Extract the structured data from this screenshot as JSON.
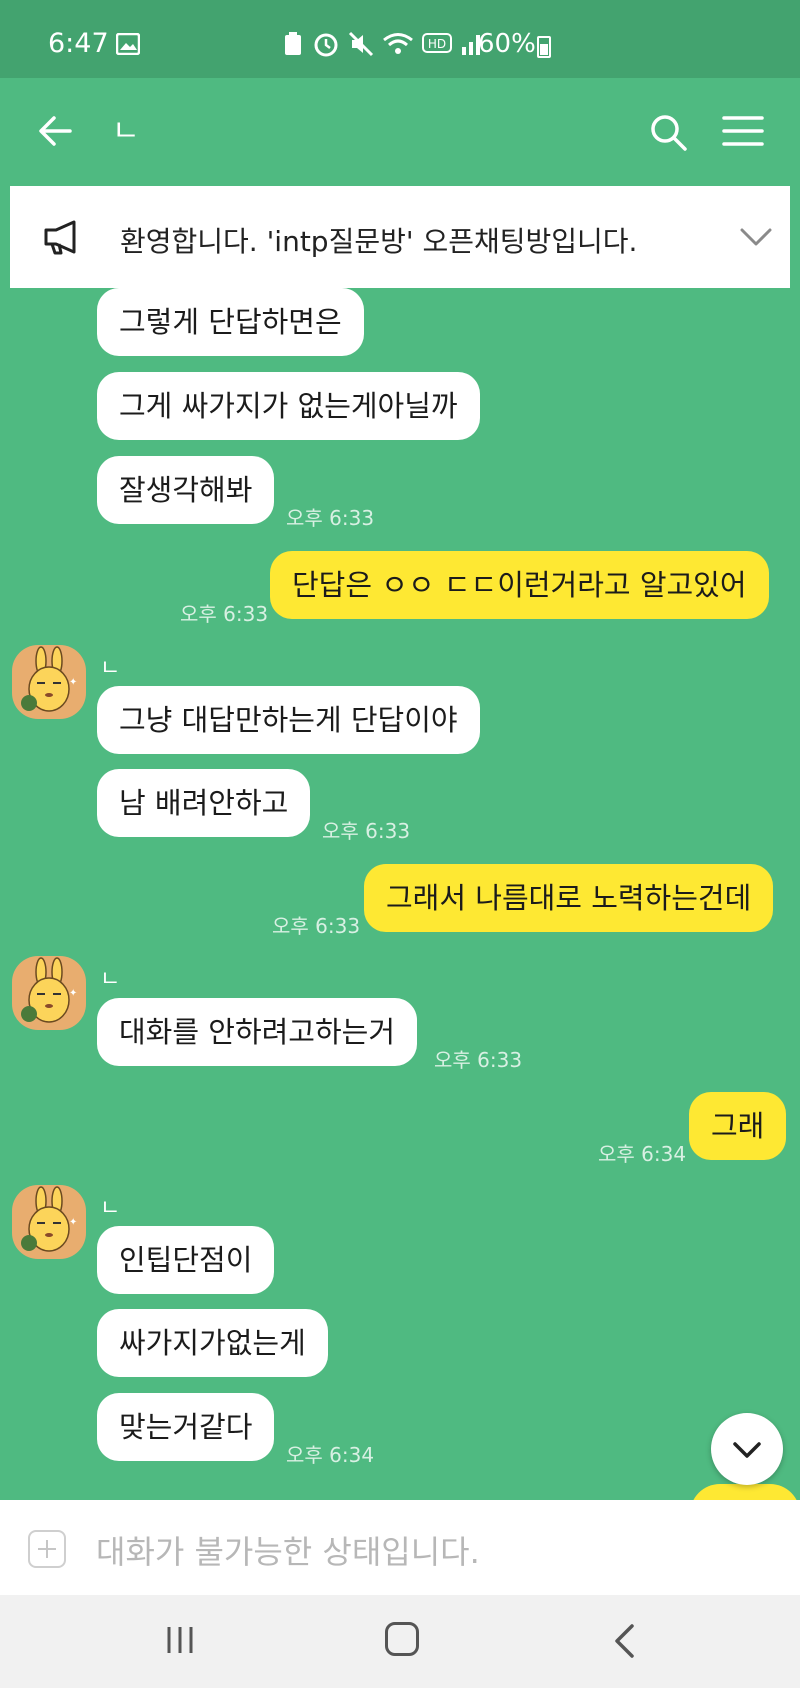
{
  "status_bar": {
    "time": "6:47",
    "battery": "60%"
  },
  "header": {
    "room_title": "ㄴ"
  },
  "notice": {
    "text": "환영합니다. 'intp질문방' 오픈채팅방입니다."
  },
  "messages": {
    "m1": "그렇게  단답하면은",
    "m2": "그게 싸가지가 없는게아닐까",
    "m3": "잘생각해봐",
    "t1": "오후 6:33",
    "m4": "단답은 ㅇㅇ ㄷㄷ이런거라고 알고있어",
    "t2": "오후 6:33",
    "s1": "ㄴ",
    "m5": "그냥 대답만하는게 단답이야",
    "m6": "남 배려안하고",
    "t3": "오후 6:33",
    "m7": "그래서 나름대로 노력하는건데",
    "t4": "오후 6:33",
    "s2": "ㄴ",
    "m8": "대화를 안하려고하는거",
    "t5": "오후 6:33",
    "m9": "그래",
    "t6": "오후 6:34",
    "s3": "ㄴ",
    "m10": "인팁단점이",
    "m11": "싸가지가없는게",
    "m12": "맞는거같다",
    "t7": "오후 6:34"
  },
  "input": {
    "placeholder": "대화가 불가능한 상태입니다."
  },
  "colors": {
    "chat_bg": "#4fba81",
    "status_bg": "#43a36f",
    "my_bubble": "#fee833",
    "other_bubble": "#ffffff"
  }
}
